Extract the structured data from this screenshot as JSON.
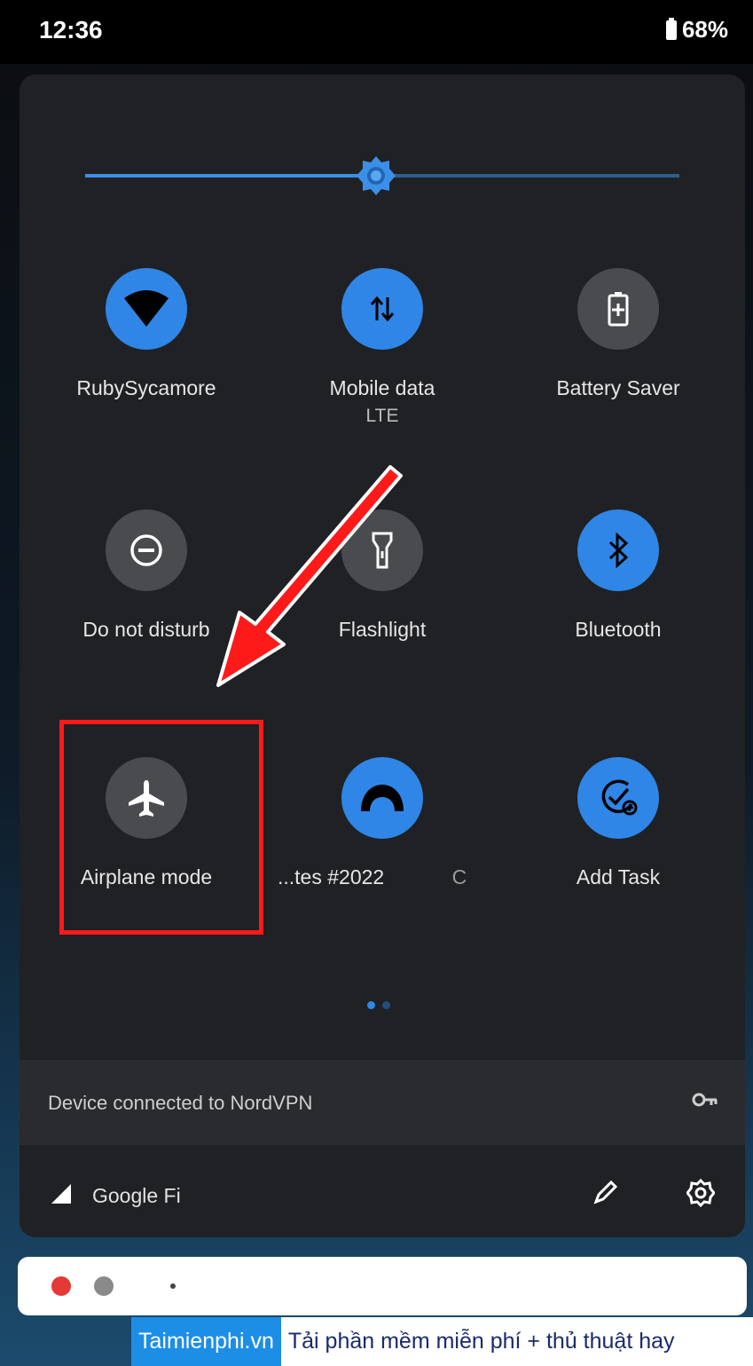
{
  "status_bar": {
    "time": "12:36",
    "battery": "68%"
  },
  "brightness": {
    "level": 0.49
  },
  "tiles": [
    {
      "label": "RubySycamore",
      "sub": "",
      "state": "on",
      "icon": "wifi-icon"
    },
    {
      "label": "Mobile data",
      "sub": "LTE",
      "state": "on",
      "icon": "mobile-data-icon"
    },
    {
      "label": "Battery Saver",
      "sub": "",
      "state": "off",
      "icon": "battery-saver-icon"
    },
    {
      "label": "Do not disturb",
      "sub": "",
      "state": "off",
      "icon": "do-not-disturb-icon"
    },
    {
      "label": "Flashlight",
      "sub": "",
      "state": "off",
      "icon": "flashlight-icon"
    },
    {
      "label": "Bluetooth",
      "sub": "",
      "state": "on",
      "icon": "bluetooth-icon"
    },
    {
      "label": "Airplane mode",
      "sub": "",
      "state": "off",
      "icon": "airplane-icon"
    },
    {
      "label": "...tes #2022",
      "sub": "",
      "state": "on",
      "icon": "app-icon"
    },
    {
      "label": "Add Task",
      "sub": "",
      "state": "on",
      "icon": "add-task-icon"
    }
  ],
  "partial_label": "C",
  "page_dots": {
    "count": 2,
    "active": 0
  },
  "vpn": {
    "text": "Device connected to NordVPN",
    "icon": "key-icon"
  },
  "carrier": {
    "name": "Google Fi",
    "icon": "signal-icon"
  },
  "footer_icons": [
    "edit-icon",
    "settings-icon"
  ],
  "notification_icons": [
    "spotify-icon",
    "app-icon"
  ],
  "watermark": {
    "brand": "Taimienphi.vn",
    "text": "Tải phần mềm miễn phí + thủ thuật hay"
  },
  "colors": {
    "accent": "#2f86e6",
    "inactive": "#4a4b4e",
    "panel": "#202124",
    "highlight": "#ff1a1a"
  }
}
